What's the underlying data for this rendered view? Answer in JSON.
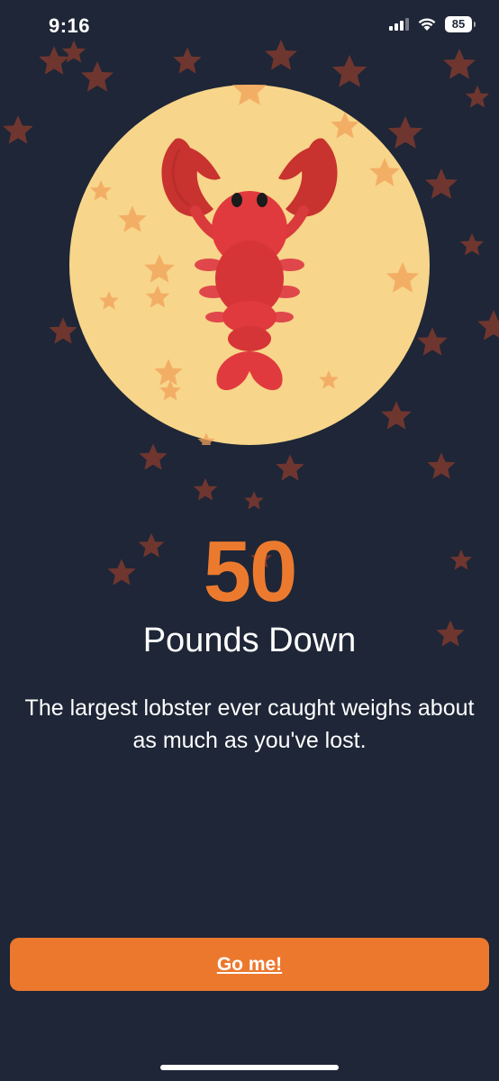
{
  "status_bar": {
    "time": "9:16",
    "battery": "85"
  },
  "achievement": {
    "number": "50",
    "unit_label": "Pounds Down",
    "description": "The largest lobster ever caught weighs about as much as you've lost.",
    "illustration": "lobster-icon"
  },
  "cta": {
    "label": "Go me!"
  },
  "colors": {
    "background": "#1e2637",
    "accent": "#ec782e",
    "moon": "#f7d58a",
    "lobster": "#e03a3e",
    "star": "#f2a15a"
  }
}
